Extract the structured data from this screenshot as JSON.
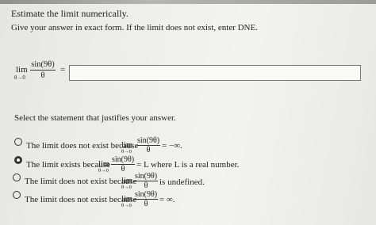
{
  "header": {
    "title": "Estimate the limit numerically.",
    "instruction": "Give your answer in exact form. If the limit does not exist, enter DNE."
  },
  "expression": {
    "lim": "lim",
    "sub": "θ→0",
    "numerator": "sin(9θ)",
    "denominator": "θ",
    "equals": "="
  },
  "answer": {
    "value": "",
    "placeholder": ""
  },
  "statement_prompt": "Select the statement that justifies your answer.",
  "options": [
    {
      "prefix": "The limit does not exist because",
      "lim": "lim",
      "sub": "θ→0",
      "num": "sin(9θ)",
      "den": "θ",
      "suffix": "= −∞.",
      "selected": false
    },
    {
      "prefix": "The limit exists because",
      "lim": "lim",
      "sub": "θ→0",
      "num": "sin(9θ)",
      "den": "θ",
      "suffix": "= L where L is a real number.",
      "selected": true
    },
    {
      "prefix": "The limit does not exist because",
      "lim": "lim",
      "sub": "θ→0",
      "num": "sin(9θ)",
      "den": "θ",
      "suffix": "is undefined.",
      "selected": false
    },
    {
      "prefix": "The limit does not exist because",
      "lim": "lim",
      "sub": "θ→0",
      "num": "sin(9θ)",
      "den": "θ",
      "suffix": "= ∞.",
      "selected": false
    }
  ]
}
